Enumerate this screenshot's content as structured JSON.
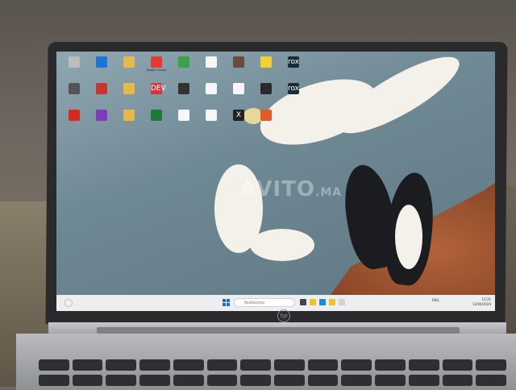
{
  "watermark": {
    "text": "AVITO",
    "suffix": ".MA"
  },
  "taskbar": {
    "search_placeholder": "Rechercher",
    "tray_lang": "ENG",
    "clock_time": "12:21",
    "clock_date": "14/04/2024"
  },
  "desktop_icons": [
    {
      "label": "",
      "color": "#bdbdbd"
    },
    {
      "label": "",
      "color": "#1e73d6"
    },
    {
      "label": "",
      "color": "#e8b84a"
    },
    {
      "label": "Google Chrome",
      "color": "#e33b2e"
    },
    {
      "label": "",
      "color": "#3aa14c"
    },
    {
      "label": "",
      "color": "#f7f7f7"
    },
    {
      "label": "",
      "color": "#6b4b3a"
    },
    {
      "label": "",
      "color": "#f2d233"
    },
    {
      "label": "rox",
      "color": "#1c2b3a"
    },
    {
      "label": "",
      "color": "#555"
    },
    {
      "label": "",
      "color": "#c33"
    },
    {
      "label": "",
      "color": "#e8b84a"
    },
    {
      "label": "DEV",
      "color": "#d6343f"
    },
    {
      "label": "",
      "color": "#333"
    },
    {
      "label": "",
      "color": "#f7f7f7"
    },
    {
      "label": "",
      "color": "#f7f7f7"
    },
    {
      "label": "",
      "color": "#2a2a2a"
    },
    {
      "label": "rox",
      "color": "#1c2b3a"
    },
    {
      "label": "",
      "color": "#d52b1e"
    },
    {
      "label": "",
      "color": "#7d3bbd"
    },
    {
      "label": "",
      "color": "#e8b84a"
    },
    {
      "label": "",
      "color": "#1d7a3c"
    },
    {
      "label": "",
      "color": "#f7f7f7"
    },
    {
      "label": "",
      "color": "#f7f7f7"
    },
    {
      "label": "X",
      "color": "#222"
    },
    {
      "label": "",
      "color": "#e45a2a"
    }
  ]
}
